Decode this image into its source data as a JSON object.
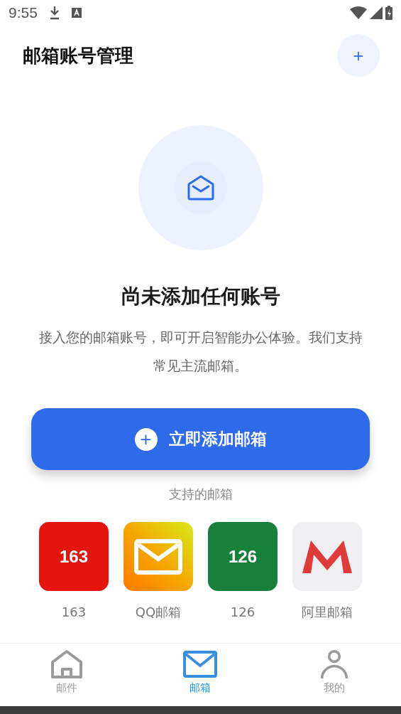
{
  "status_bar": {
    "time": "9:55"
  },
  "header": {
    "title": "邮箱账号管理",
    "add_button": "+"
  },
  "empty_state": {
    "title": "尚未添加任何账号",
    "description": "接入您的邮箱账号，即可开启智能办公体验。我们支持常见主流邮箱。"
  },
  "add_button": {
    "icon": "+",
    "label": "立即添加邮箱"
  },
  "providers": {
    "title": "支持的邮箱",
    "items": [
      {
        "kind": "text",
        "logo": "163",
        "label": "163",
        "color": "#e3150c"
      },
      {
        "kind": "envelope",
        "label": "QQ邮箱",
        "color": "#f5a800"
      },
      {
        "kind": "text",
        "logo": "126",
        "label": "126",
        "color": "#16803c"
      },
      {
        "kind": "m",
        "label": "阿里邮箱",
        "color": "#f0f0f2"
      }
    ]
  },
  "bottom_nav": [
    {
      "kind": "home",
      "label": "邮件",
      "selected": false
    },
    {
      "kind": "mail",
      "label": "邮箱",
      "selected": true
    },
    {
      "kind": "person",
      "label": "我的",
      "selected": false
    }
  ]
}
